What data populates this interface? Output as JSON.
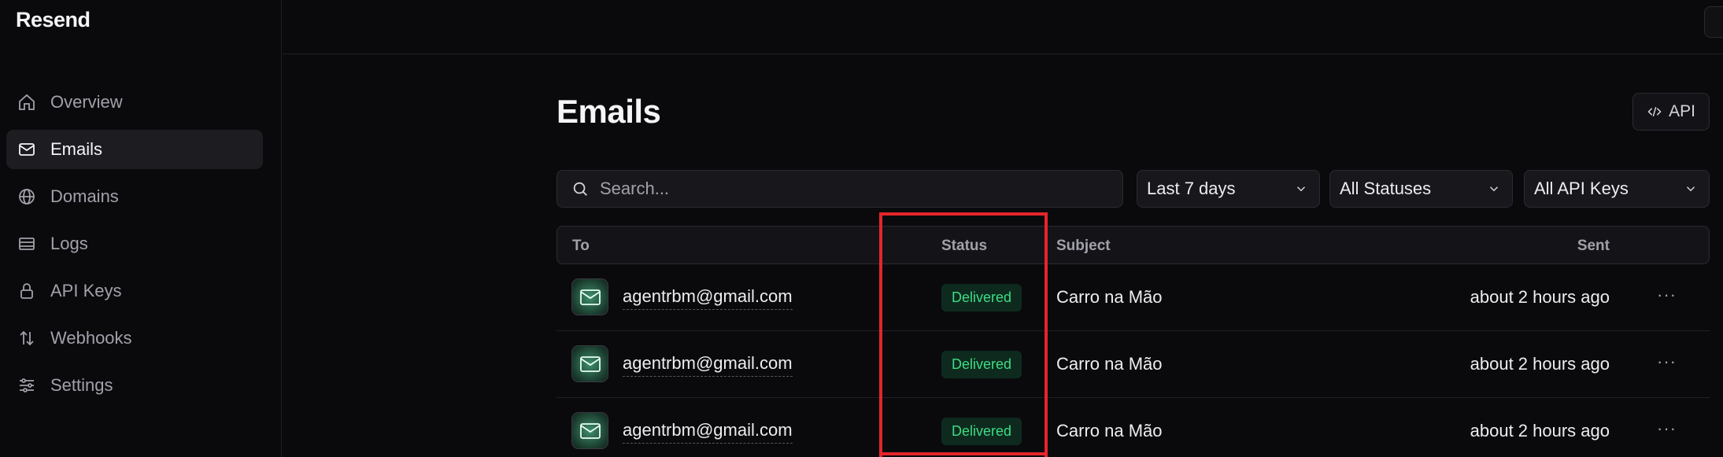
{
  "app": {
    "logo": "Resend"
  },
  "sidebar": {
    "items": [
      {
        "label": "Overview",
        "icon": "home-icon",
        "active": false
      },
      {
        "label": "Emails",
        "icon": "mail-icon",
        "active": true
      },
      {
        "label": "Domains",
        "icon": "globe-icon",
        "active": false
      },
      {
        "label": "Logs",
        "icon": "logs-icon",
        "active": false
      },
      {
        "label": "API Keys",
        "icon": "lock-icon",
        "active": false
      },
      {
        "label": "Webhooks",
        "icon": "webhook-icon",
        "active": false
      },
      {
        "label": "Settings",
        "icon": "sliders-icon",
        "active": false
      }
    ]
  },
  "main": {
    "title": "Emails",
    "api_button": "API",
    "search": {
      "placeholder": "Search..."
    },
    "filters": {
      "date": "Last 7 days",
      "status": "All Statuses",
      "api_keys": "All API Keys"
    },
    "table": {
      "headers": {
        "to": "To",
        "status": "Status",
        "subject": "Subject",
        "sent": "Sent"
      },
      "rows": [
        {
          "to": "agentrbm@gmail.com",
          "status": "Delivered",
          "subject": "Carro na Mão",
          "sent": "about 2 hours ago"
        },
        {
          "to": "agentrbm@gmail.com",
          "status": "Delivered",
          "subject": "Carro na Mão",
          "sent": "about 2 hours ago"
        },
        {
          "to": "agentrbm@gmail.com",
          "status": "Delivered",
          "subject": "Carro na Mão",
          "sent": "about 2 hours ago"
        }
      ],
      "more_label": "···"
    }
  },
  "colors": {
    "background": "#0a0a0d",
    "delivered_text": "#3ddc84",
    "delivered_bg": "#0e2a1e",
    "highlight": "#e5252a"
  }
}
